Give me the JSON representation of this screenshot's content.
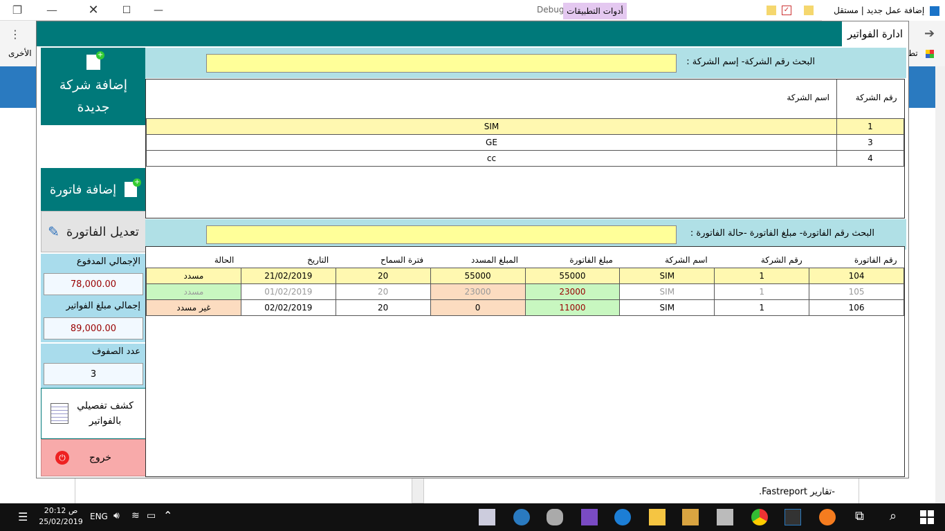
{
  "browser": {
    "tab_title": "إضافة عمل جديد | مستقل",
    "bookmark_text": "الأخرى",
    "bookmark_text_right": "تط"
  },
  "app": {
    "window_title": "ادارة الفواتير",
    "debug_label": "Debug",
    "tools_label": "أدوات التطبيقات"
  },
  "sidebar": {
    "add_company_label": "إضافة شركة جديدة",
    "add_invoice_label": "إضافة فاتورة",
    "edit_invoice_label": "تعديل الفاتورة",
    "total_paid_label": "الإجمالي المدفوع",
    "total_paid_value": "78,000.00",
    "total_invoices_label": "إجمالي مبلغ الفواتير",
    "total_invoices_value": "89,000.00",
    "row_count_label": "عدد الصفوف",
    "row_count_value": "3",
    "report_label": "كشف تفصيلي بالفواتير",
    "exit_label": "خروج"
  },
  "company_search": {
    "label": "البحث رقم الشركة- إسم الشركة  :"
  },
  "companies": {
    "headers": [
      "رقم الشركة",
      "اسم الشركة"
    ],
    "rows": [
      [
        "1",
        "SIM"
      ],
      [
        "3",
        "GE"
      ],
      [
        "4",
        "cc"
      ]
    ]
  },
  "invoice_search": {
    "label": "البحث رقم الفاتورة- مبلغ الفاتورة -حالة الفاتورة :"
  },
  "invoices": {
    "headers": [
      "رقم الفاتورة",
      "رقم الشركة",
      "اسم الشركة",
      "مبلغ  الفاتورة",
      "المبلغ المسدد",
      "فترة السماح",
      "التاريخ",
      "الحالة"
    ],
    "rows": [
      [
        "104",
        "1",
        "SIM",
        "55000",
        "55000",
        "20",
        "21/02/2019",
        "مسدد"
      ],
      [
        "105",
        "1",
        "SIM",
        "23000",
        "23000",
        "20",
        "01/02/2019",
        "مسدد"
      ],
      [
        "106",
        "1",
        "SIM",
        "11000",
        "0",
        "20",
        "02/02/2019",
        "غير مسدد"
      ]
    ]
  },
  "background_doc": {
    "line": "-تقارير Fastreport."
  },
  "taskbar": {
    "time": "20:12 ص",
    "date": "25/02/2019",
    "lang": "ENG"
  },
  "colors": {
    "teal": "#00797a",
    "search_bg": "#b0e0e6",
    "search_input": "#ffff99",
    "selected_row": "#fff8b0",
    "paid_green": "#c8f7c0",
    "unpaid_peach": "#fcdcc0",
    "exit_red": "#f8aaaa"
  }
}
